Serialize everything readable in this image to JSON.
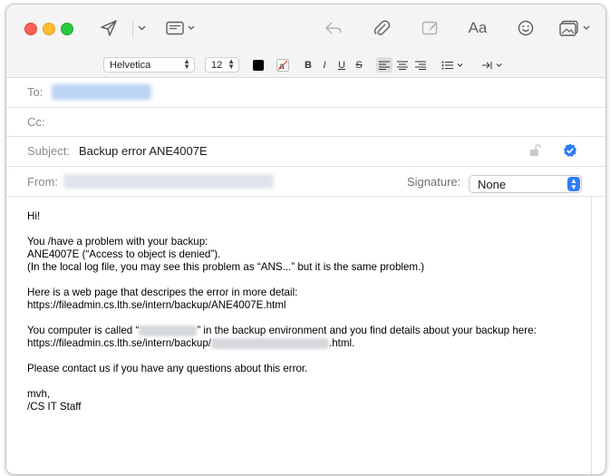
{
  "toolbar": {
    "buttons": [
      "send-icon",
      "chevron-down-icon",
      "header-fields-icon",
      "reply-icon",
      "paperclip-icon",
      "markup-icon",
      "font-panel-label",
      "emoji-icon",
      "photo-browser-icon"
    ],
    "font_panel_label": "Aa"
  },
  "format": {
    "font": "Helvetica",
    "size": "12",
    "bold": "B",
    "italic": "I",
    "underline": "U",
    "strike": "S"
  },
  "headers": {
    "to_label": "To:",
    "cc_label": "Cc:",
    "subject_label": "Subject:",
    "subject_value": "Backup error ANE4007E",
    "from_label": "From:",
    "signature_label": "Signature:",
    "signature_value": "None"
  },
  "body": {
    "greeting": "Hi!",
    "line1": "You /have a problem with your backup:",
    "line2": "ANE4007E (“Access to object is denied”).",
    "line3": "(In the local log file, you may see this problem as “ANS...” but it is the same problem.)",
    "line4": "Here is a web page that descripes the error in more detail:",
    "line5": "https://fileadmin.cs.lth.se/intern/backup/ANE4007E.html",
    "line6a": "You computer is called “",
    "line6b": "” in the backup environment and you find details about your backup here:",
    "line7a": "https://fileadmin.cs.lth.se/intern/backup/",
    "line7b": ".html.",
    "line8": "Please contact us if you have any questions about this error.",
    "signoff1": "mvh,",
    "signoff2": "/CS IT Staff"
  },
  "colors": {
    "accent": "#2f7cf6",
    "traffic_red": "#ff5f57",
    "traffic_yellow": "#febc2e",
    "traffic_green": "#28c840"
  }
}
